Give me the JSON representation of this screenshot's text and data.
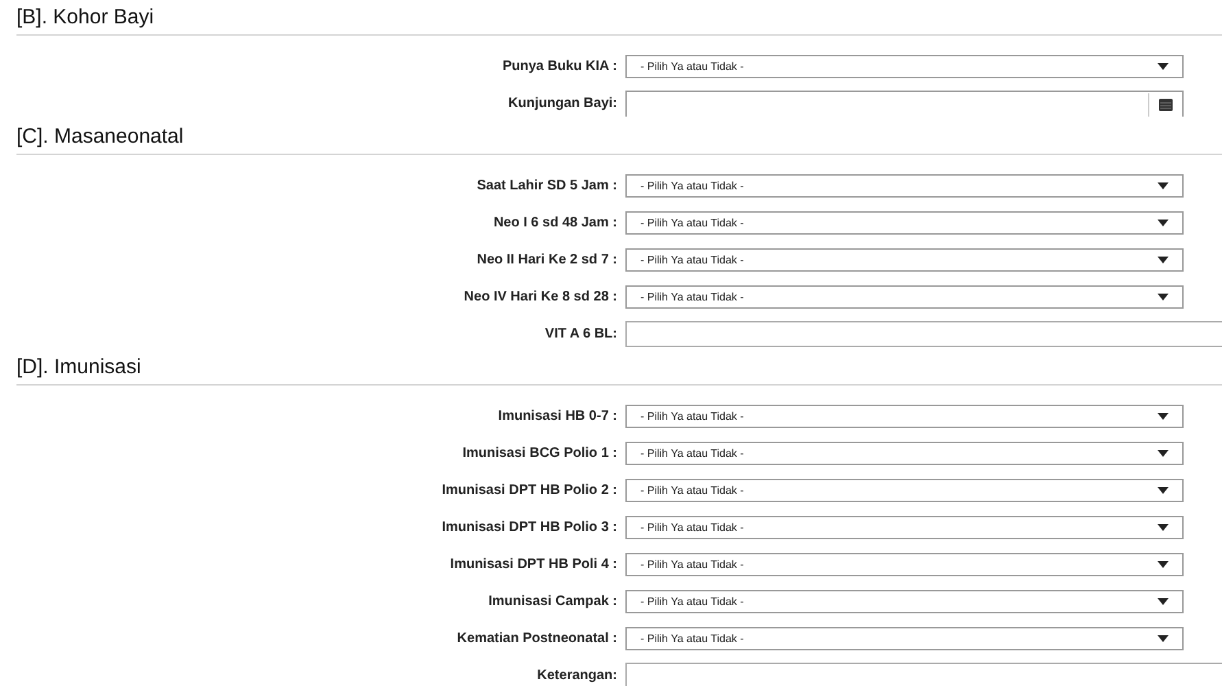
{
  "sections": [
    {
      "title": "[B]. Kohor Bayi",
      "fields": [
        {
          "label": "Punya Buku KIA :",
          "kind": "select",
          "value": "- Pilih Ya atau Tidak -"
        },
        {
          "label": "Kunjungan Bayi:",
          "kind": "date"
        }
      ]
    },
    {
      "title": "[C]. Masaneonatal",
      "fields": [
        {
          "label": "Saat Lahir SD 5 Jam :",
          "kind": "select",
          "value": "- Pilih Ya atau Tidak -"
        },
        {
          "label": "Neo I 6 sd 48 Jam :",
          "kind": "select",
          "value": "- Pilih Ya atau Tidak -"
        },
        {
          "label": "Neo II Hari Ke 2 sd 7 :",
          "kind": "select",
          "value": "- Pilih Ya atau Tidak -"
        },
        {
          "label": "Neo IV Hari Ke 8 sd 28 :",
          "kind": "select",
          "value": "- Pilih Ya atau Tidak -"
        },
        {
          "label": "VIT A 6 BL:",
          "kind": "text"
        }
      ]
    },
    {
      "title": "[D]. Imunisasi",
      "fields": [
        {
          "label": "Imunisasi HB 0-7 :",
          "kind": "select",
          "value": "- Pilih Ya atau Tidak -"
        },
        {
          "label": "Imunisasi BCG Polio 1 :",
          "kind": "select",
          "value": "- Pilih Ya atau Tidak -"
        },
        {
          "label": "Imunisasi DPT HB Polio 2 :",
          "kind": "select",
          "value": "- Pilih Ya atau Tidak -"
        },
        {
          "label": "Imunisasi DPT HB Polio 3 :",
          "kind": "select",
          "value": "- Pilih Ya atau Tidak -"
        },
        {
          "label": "Imunisasi DPT HB Poli 4 :",
          "kind": "select",
          "value": "- Pilih Ya atau Tidak -"
        },
        {
          "label": "Imunisasi Campak :",
          "kind": "select",
          "value": "- Pilih Ya atau Tidak -"
        },
        {
          "label": "Kematian Postneonatal :",
          "kind": "select",
          "value": "- Pilih Ya atau Tidak -"
        },
        {
          "label": "Keterangan:",
          "kind": "text"
        }
      ]
    }
  ]
}
